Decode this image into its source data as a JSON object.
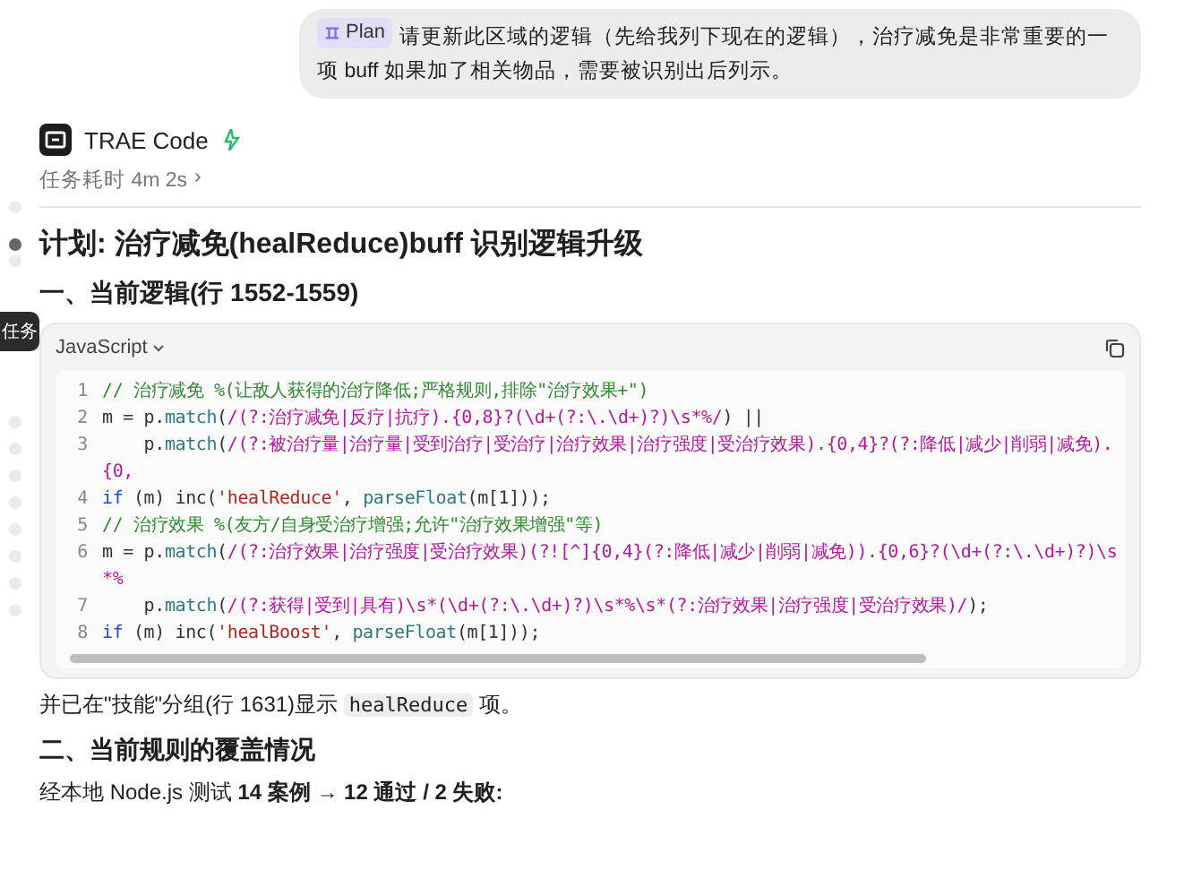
{
  "user_message": {
    "badge": "Plan",
    "text": "请更新此区域的逻辑（先给我列下现在的逻辑），治疗减免是非常重要的一项 buff 如果加了相关物品，需要被识别出后列示。"
  },
  "agent": {
    "name": "TRAE Code",
    "duration": "任务耗时 4m 2s",
    "duration_chevron": "›"
  },
  "side_tab": "任务",
  "title": {
    "text": "计划: 治疗减免(healReduce)buff 识别逻辑升级",
    "current": true
  },
  "section_1": "一、当前逻辑(行 1552-1559)",
  "code_block": {
    "language": "JavaScript",
    "lines": [
      {
        "number": "1",
        "tokens": [
          {
            "kind": "comment",
            "text": "// 治疗减免 %(让敌人获得的治疗降低;严格规则,排除\"治疗效果+\")"
          }
        ]
      },
      {
        "number": "2",
        "tokens": [
          {
            "kind": "plain",
            "text": "m = p."
          },
          {
            "kind": "func",
            "text": "match"
          },
          {
            "kind": "plain",
            "text": "("
          },
          {
            "kind": "regex",
            "text": "/(?:治疗减免|反疗|抗疗).{0,8}?(\\d+(?:\\.\\d+)?)\\s*%/"
          },
          {
            "kind": "plain",
            "text": ") ||"
          }
        ]
      },
      {
        "number": "3",
        "tokens": [
          {
            "kind": "plain",
            "text": "    p."
          },
          {
            "kind": "func",
            "text": "match"
          },
          {
            "kind": "plain",
            "text": "("
          },
          {
            "kind": "regex",
            "text": "/(?:被治疗量|治疗量|受到治疗|受治疗|治疗效果|治疗强度|受治疗效果).{0,4}?(?:降低|减少|削弱|减免).{0,"
          }
        ]
      },
      {
        "number": "4",
        "tokens": [
          {
            "kind": "keyword",
            "text": "if"
          },
          {
            "kind": "plain",
            "text": " (m) inc("
          },
          {
            "kind": "string",
            "text": "'healReduce'"
          },
          {
            "kind": "plain",
            "text": ", "
          },
          {
            "kind": "func",
            "text": "parseFloat"
          },
          {
            "kind": "plain",
            "text": "(m[1]));"
          }
        ]
      },
      {
        "number": "5",
        "tokens": [
          {
            "kind": "comment",
            "text": "// 治疗效果 %(友方/自身受治疗增强;允许\"治疗效果增强\"等)"
          }
        ]
      },
      {
        "number": "6",
        "tokens": [
          {
            "kind": "plain",
            "text": "m = p."
          },
          {
            "kind": "func",
            "text": "match"
          },
          {
            "kind": "plain",
            "text": "("
          },
          {
            "kind": "regex",
            "text": "/(?:治疗效果|治疗强度|受治疗效果)(?![^]{0,4}(?:降低|减少|削弱|减免)).{0,6}?(\\d+(?:\\.\\d+)?)\\s*%"
          }
        ]
      },
      {
        "number": "7",
        "tokens": [
          {
            "kind": "plain",
            "text": "    p."
          },
          {
            "kind": "func",
            "text": "match"
          },
          {
            "kind": "plain",
            "text": "("
          },
          {
            "kind": "regex",
            "text": "/(?:获得|受到|具有)\\s*(\\d+(?:\\.\\d+)?)\\s*%\\s*(?:治疗效果|治疗强度|受治疗效果)/"
          },
          {
            "kind": "plain",
            "text": ");"
          }
        ]
      },
      {
        "number": "8",
        "tokens": [
          {
            "kind": "keyword",
            "text": "if"
          },
          {
            "kind": "plain",
            "text": " (m) inc("
          },
          {
            "kind": "string",
            "text": "'healBoost'"
          },
          {
            "kind": "plain",
            "text": ", "
          },
          {
            "kind": "func",
            "text": "parseFloat"
          },
          {
            "kind": "plain",
            "text": "(m[1]));"
          }
        ]
      }
    ]
  },
  "note": [
    {
      "kind": "text",
      "text": "并已在\"技能\"分组(行 1631)显示 "
    },
    {
      "kind": "code",
      "text": "healReduce"
    },
    {
      "kind": "text",
      "text": " 项。"
    }
  ],
  "section_2": "二、当前规则的覆盖情况",
  "summary": "经本地 Node.js 测试 **14 案例 → 12 通过 / 2 失败:**"
}
